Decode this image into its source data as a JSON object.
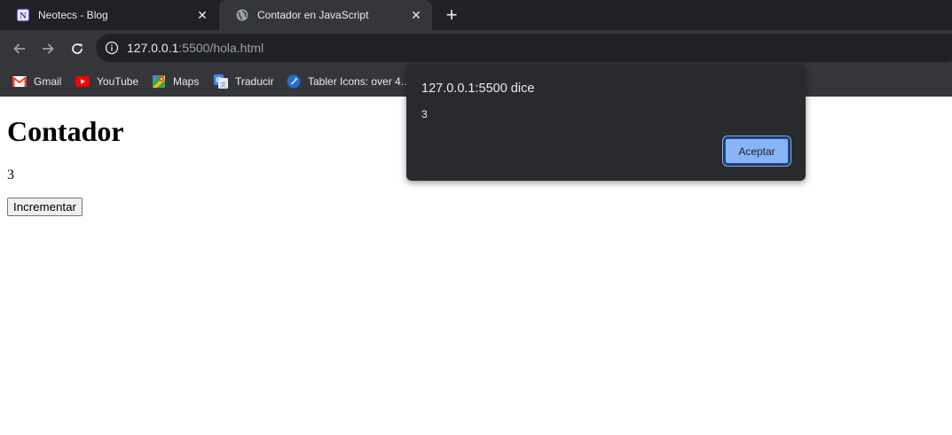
{
  "browser": {
    "tabs": [
      {
        "title": "Neotecs - Blog",
        "icon": "notion-icon",
        "active": false
      },
      {
        "title": "Contador en JavaScript",
        "icon": "globe-icon",
        "active": true
      }
    ],
    "new_tab_label": "+",
    "address": {
      "host": "127.0.0.1",
      "rest": ":5500/hola.html"
    },
    "bookmarks": [
      {
        "label": "Gmail",
        "icon": "gmail-icon"
      },
      {
        "label": "YouTube",
        "icon": "youtube-icon"
      },
      {
        "label": "Maps",
        "icon": "maps-icon"
      },
      {
        "label": "Traducir",
        "icon": "translate-icon"
      },
      {
        "label": "Tabler Icons: over 4...",
        "icon": "tabler-icon"
      }
    ]
  },
  "page": {
    "heading": "Contador",
    "count": "3",
    "button_label": "Incrementar"
  },
  "dialog": {
    "title": "127.0.0.1:5500 dice",
    "message": "3",
    "ok_label": "Aceptar"
  },
  "colors": {
    "tabstrip": "#202124",
    "toolbar": "#35363a",
    "dialog_bg": "#292a2d",
    "dialog_button": "#8ab4f8"
  }
}
